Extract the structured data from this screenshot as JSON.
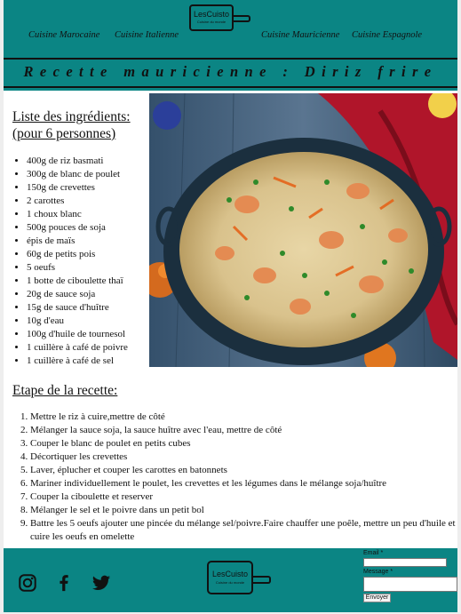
{
  "brand": {
    "name": "LesCuisto",
    "tagline": "Cuisine du monde"
  },
  "nav": {
    "items": [
      {
        "label": "Cuisine Marocaine"
      },
      {
        "label": "Cuisine Italienne"
      },
      {
        "label": "Cuisine Mauricienne"
      },
      {
        "label": "Cuisine Espagnole"
      }
    ]
  },
  "recipe": {
    "title": "Recette mauricienne : Diriz frire",
    "ingredients_title": "Liste des ingrédients:",
    "servings": "(pour 6 personnes)",
    "ingredients": [
      "400g de riz basmati",
      "300g de blanc de poulet",
      "150g de crevettes",
      "2 carottes",
      "1 choux blanc",
      "500g pouces de soja",
      "épis de maïs",
      "60g de petits pois",
      "5 oeufs",
      "1 botte de ciboulette thaï",
      "20g de sauce soja",
      "15g de sauce d'huître",
      "10g d'eau",
      "100g d'huile de tournesol",
      "1 cuillère à café de poivre",
      "1 cuillère à café de sel"
    ],
    "steps_title": "Etape de la recette:",
    "steps": [
      "Mettre le riz à cuire,mettre de côté",
      "Mélanger la sauce soja, la sauce huître avec l'eau, mettre de côté",
      "Couper le blanc de poulet en petits cubes",
      "Décortiquer les crevettes",
      "Laver, éplucher et couper les carottes en batonnets",
      "Mariner individuellement le poulet, les crevettes et les légumes dans le mélange soja/huître",
      "Couper la ciboulette et reserver",
      "Mélanger le sel et le poivre dans un petit bol",
      "Battre les 5 oeufs ajouter une pincée du mélange sel/poivre.Faire chauffer une poêle, mettre un peu d'huile et cuire les oeufs en omelette"
    ]
  },
  "footer": {
    "social": [
      {
        "icon": "instagram-icon"
      },
      {
        "icon": "facebook-icon"
      },
      {
        "icon": "twitter-icon"
      }
    ],
    "form": {
      "email_label": "Email *",
      "message_label": "Message *",
      "send_label": "Envoyer"
    }
  },
  "colors": {
    "teal": "#0b8584",
    "text": "#111111"
  }
}
